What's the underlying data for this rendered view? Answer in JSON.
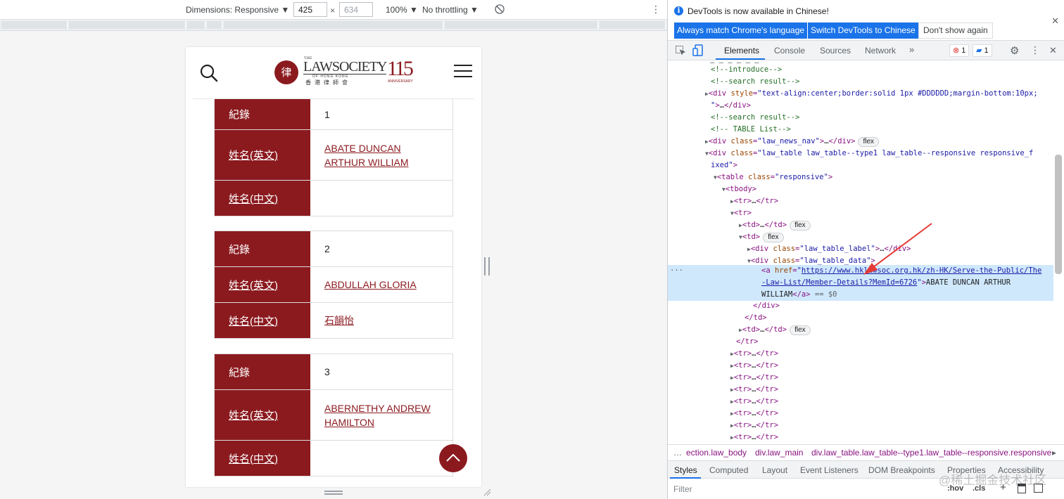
{
  "emulation_toolbar": {
    "dimensions_label": "Dimensions: Responsive ▼",
    "width_value": "425",
    "times": "×",
    "height_value": "634",
    "zoom": "100% ▼",
    "throttling": "No throttling ▼"
  },
  "records": [
    {
      "label_record": "紀錄",
      "record_no": "1",
      "label_en": "姓名(英文)",
      "name_en": "ABATE DUNCAN ARTHUR WILLIAM",
      "label_zh": "姓名(中文)",
      "name_zh": ""
    },
    {
      "label_record": "紀錄",
      "record_no": "2",
      "label_en": "姓名(英文)",
      "name_en": "ABDULLAH GLORIA",
      "label_zh": "姓名(中文)",
      "name_zh": "石韻怡"
    },
    {
      "label_record": "紀錄",
      "record_no": "3",
      "label_en": "姓名(英文)",
      "name_en": "ABERNETHY ANDREW HAMILTON",
      "label_zh": "姓名(中文)",
      "name_zh": ""
    }
  ],
  "logo": {
    "the": "THE",
    "main": "LAWSOCIETY",
    "hk": "OF HONG KONG",
    "cn": "香港律師會",
    "anniv_number": "115",
    "anniv_label": "ANNIVERSARY",
    "seal": "律"
  },
  "devtools": {
    "info_text": "DevTools is now available in Chinese!",
    "btn_match": "Always match Chrome's language",
    "btn_switch": "Switch DevTools to Chinese",
    "btn_dont": "Don't show again",
    "tabs": [
      "Elements",
      "Console",
      "Sources",
      "Network"
    ],
    "error_count": "1",
    "message_count": "1",
    "breadcrumbs": [
      "ection.law_body",
      "div.law_main",
      "div.law_table.law_table--type1.law_table--responsive.responsive"
    ],
    "subtabs": [
      "Styles",
      "Computed",
      "Layout",
      "Event Listeners",
      "DOM Breakpoints",
      "Properties",
      "Accessibility"
    ],
    "filter_placeholder": "Filter",
    "filter_hov": ":hov",
    "filter_cls": ".cls",
    "flex_badge": "flex",
    "dom": {
      "c_introduce": "<!--introduce-->",
      "c_search1": "<!--search result-->",
      "div_style_attr": "text-align:center;border:solid 1px #DDDDDD;margin-bottom:10px;",
      "c_search2": "<!--search result-->",
      "c_table_list": "<!-- TABLE List-->",
      "news_nav_class": "law_news_nav",
      "law_table_class1": "law_table law_table--type1  law_table--responsive responsive_f",
      "law_table_class2": "ixed",
      "table_class": "responsive",
      "label_class": "law_table_label",
      "data_class": "law_table_data",
      "href1": "https://www.hklawsoc.org.hk/zh-HK/Serve-the-Public/The",
      "href2": "-Law-List/Member-Details?MemId=6726",
      "a_text1": "ABATE DUNCAN ARTHUR",
      "a_text2": "WILLIAM",
      "eq_ref": "== $0"
    }
  },
  "watermark": "@稀土掘金技术社区",
  "colors": {
    "brand": "#8b1a1f",
    "devtools_accent": "#1a73e8",
    "selection": "#cfe8fc"
  }
}
